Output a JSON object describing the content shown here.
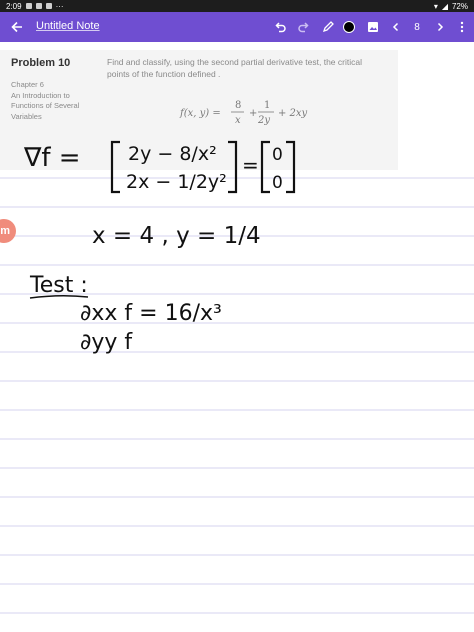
{
  "status_bar": {
    "time": "2:09",
    "battery": "72%"
  },
  "app_bar": {
    "note_title": "Untitled Note",
    "page_number": "8",
    "brand_color": "#6f4ed1"
  },
  "problem": {
    "title": "Problem 10",
    "chapter_lines": [
      "Chapter 6",
      "An Introduction to",
      "Functions of Several",
      "Variables"
    ],
    "text": "Find and classify, using the second partial derivative test, the critical points of the function defined .",
    "formula": {
      "lhs": "f(x, y) =",
      "frac1_num": "8",
      "frac1_den": "x",
      "plus1": "+",
      "frac2_num": "1",
      "frac2_den": "2y",
      "tail": "+ 2xy"
    }
  },
  "handwriting": {
    "gradient_lhs": "∇f =",
    "row1": "2y − 8/x²",
    "row2": "2x − 1/2y²",
    "equals": "=",
    "zero1": "0",
    "zero2": "0",
    "critical_point": "x = 4 ,  y = 1/4",
    "test_label": "Test :",
    "dxx": "∂xx f = 16/x³",
    "dyy": "∂yy f"
  },
  "badge": {
    "letter": "m"
  }
}
